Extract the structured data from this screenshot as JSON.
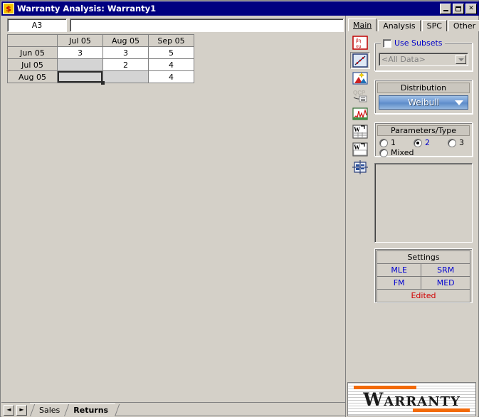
{
  "window": {
    "title": "Warranty Analysis: Warranty1",
    "icon": "dollar-icon",
    "icon_glyph": "$",
    "minimize_label": "_",
    "maximize_label": "□",
    "close_label": "✕"
  },
  "formula_bar": {
    "cell_reference": "A3",
    "formula_value": "",
    "formula_placeholder": ""
  },
  "sheet": {
    "corner_label": "",
    "column_headers": [
      "Jul 05",
      "Aug 05",
      "Sep 05"
    ],
    "rows": [
      {
        "header": "Jun 05",
        "cells": [
          {
            "value": "3",
            "state": "normal"
          },
          {
            "value": "3",
            "state": "normal"
          },
          {
            "value": "5",
            "state": "normal"
          }
        ]
      },
      {
        "header": "Jul 05",
        "cells": [
          {
            "value": "",
            "state": "disabled"
          },
          {
            "value": "2",
            "state": "normal"
          },
          {
            "value": "4",
            "state": "normal"
          }
        ]
      },
      {
        "header": "Aug 05",
        "cells": [
          {
            "value": "",
            "state": "selected-disabled"
          },
          {
            "value": "",
            "state": "disabled"
          },
          {
            "value": "4",
            "state": "normal"
          }
        ]
      }
    ]
  },
  "sheet_tabs": {
    "prev_label": "◄",
    "next_label": "►",
    "tabs": [
      {
        "label": "Sales",
        "active": false
      },
      {
        "label": "Returns",
        "active": true
      }
    ]
  },
  "right_panel": {
    "tabs": [
      {
        "label": "Main",
        "active": true
      },
      {
        "label": "Analysis",
        "active": false
      },
      {
        "label": "SPC",
        "active": false
      },
      {
        "label": "Other",
        "active": false
      }
    ],
    "toolbar_icons": [
      {
        "name": "parameters-beta-eta-icon",
        "pressed": false
      },
      {
        "name": "probability-plot-icon",
        "pressed": true
      },
      {
        "name": "plot-wizard-icon",
        "pressed": false
      },
      {
        "name": "qcp-calculator-icon",
        "pressed": false
      },
      {
        "name": "function-plot-icon",
        "pressed": false
      },
      {
        "name": "warranty-table-icon",
        "pressed": false
      },
      {
        "name": "warranty-sheet-icon",
        "pressed": false
      },
      {
        "name": "data-transfer-icon",
        "pressed": false
      }
    ],
    "subsets": {
      "checkbox_label": "Use Subsets",
      "checked": false,
      "dropdown_value": "<All Data>",
      "dropdown_enabled": false
    },
    "distribution": {
      "header": "Distribution",
      "selected": "Weibull"
    },
    "parameters": {
      "header": "Parameters/Type",
      "options": [
        {
          "label": "1",
          "selected": false
        },
        {
          "label": "2",
          "selected": true
        },
        {
          "label": "3",
          "selected": false
        },
        {
          "label": "Mixed",
          "selected": false
        }
      ]
    },
    "settings": {
      "header": "Settings",
      "row1": [
        "MLE",
        "SRM"
      ],
      "row2": [
        "FM",
        "MED"
      ],
      "status": "Edited"
    },
    "logo": {
      "text": "WARRANTY",
      "first_letter": "W",
      "rest": "ARRANTY"
    }
  },
  "colors": {
    "titlebar": "#000080",
    "face": "#d4d0c8",
    "accent_blue": "#0000c8",
    "status_red": "#d00000",
    "logo_orange": "#f26a0a"
  }
}
